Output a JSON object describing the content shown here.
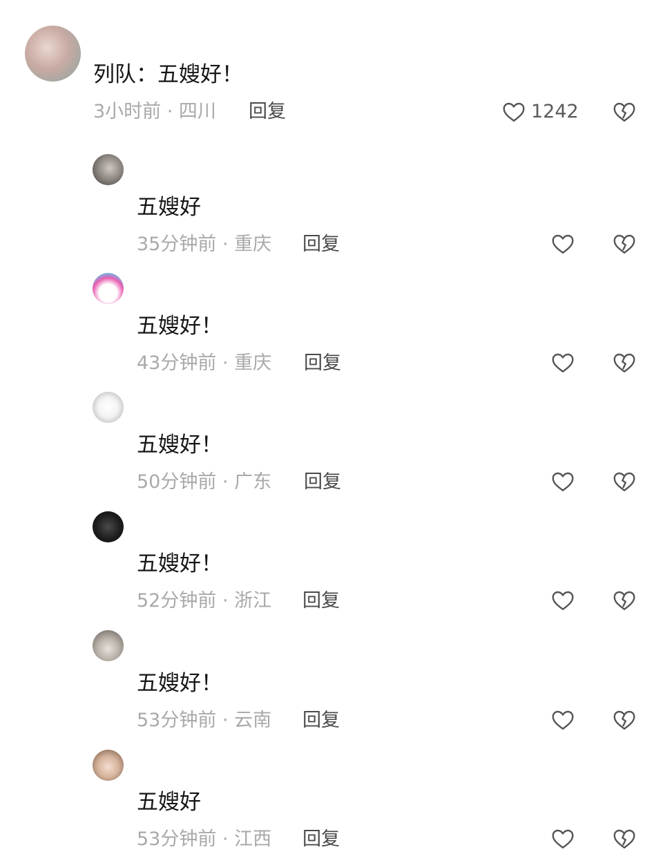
{
  "top_comment": {
    "user_label": "列队",
    "text": "列队：五嫂好！",
    "meta": "3小时前 · 四川",
    "reply_label": "回复",
    "like_count": "1242"
  },
  "replies": [
    {
      "text": "五嫂好",
      "meta": "35分钟前 · 重庆",
      "reply_label": "回复"
    },
    {
      "text": "五嫂好！",
      "meta": "43分钟前 · 重庆",
      "reply_label": "回复"
    },
    {
      "text": "五嫂好！",
      "meta": "50分钟前 · 广东",
      "reply_label": "回复"
    },
    {
      "text": "五嫂好！",
      "meta": "52分钟前 · 浙江",
      "reply_label": "回复"
    },
    {
      "text": "五嫂好！",
      "meta": "53分钟前 · 云南",
      "reply_label": "回复"
    },
    {
      "text": "五嫂好",
      "meta": "53分钟前 · 江西",
      "reply_label": "回复"
    }
  ],
  "icons": {
    "like": "heart-outline-icon",
    "dislike": "broken-heart-icon"
  }
}
